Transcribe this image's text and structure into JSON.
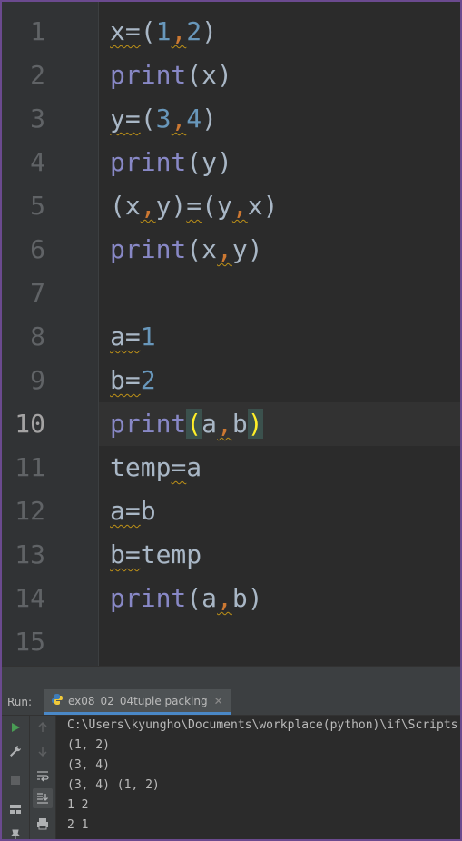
{
  "editor": {
    "lines": [
      {
        "num": "1"
      },
      {
        "num": "2"
      },
      {
        "num": "3"
      },
      {
        "num": "4"
      },
      {
        "num": "5"
      },
      {
        "num": "6"
      },
      {
        "num": "7"
      },
      {
        "num": "8"
      },
      {
        "num": "9"
      },
      {
        "num": "10"
      },
      {
        "num": "11"
      },
      {
        "num": "12"
      },
      {
        "num": "13"
      },
      {
        "num": "14"
      },
      {
        "num": "15"
      }
    ],
    "current_line": "10"
  },
  "run": {
    "label": "Run:",
    "tab_label": "ex08_02_04tuple packing",
    "console": [
      "C:\\Users\\kyungho\\Documents\\workplace(python)\\if\\Scripts",
      "(1, 2)",
      "(3, 4)",
      "(3, 4) (1, 2)",
      "1 2",
      "2 1"
    ]
  },
  "colors": {
    "background": "#2b2b2b",
    "keyword": "#8888c6",
    "number": "#6897bb",
    "text": "#a9b7c6",
    "warning": "#be9117",
    "bracket_highlight": "#ffef28",
    "run_green": "#499c54",
    "border": "#6b4a8f"
  },
  "icons": [
    "python-file-icon",
    "close-icon",
    "run-icon",
    "wrench-icon",
    "stop-icon",
    "layout-icon",
    "pin-icon",
    "up-arrow-icon",
    "down-arrow-icon",
    "soft-wrap-icon",
    "scroll-to-end-icon",
    "print-icon"
  ]
}
